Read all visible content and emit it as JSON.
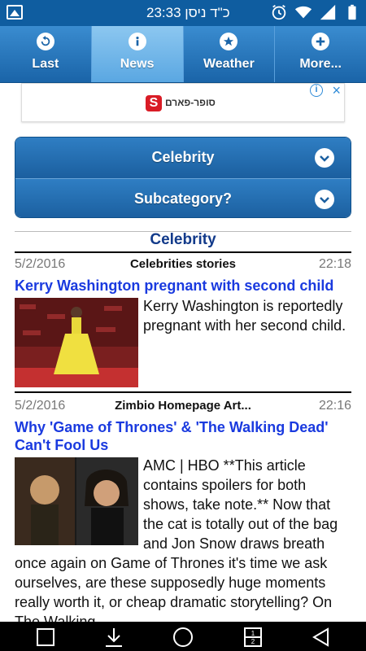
{
  "status_bar": {
    "clock": "23:33 כ\"ד ניסן",
    "icons": [
      "image-icon",
      "alarm-icon",
      "wifi-icon",
      "signal-icon",
      "battery-icon"
    ]
  },
  "tabs": [
    {
      "label": "Last",
      "icon": "back-icon",
      "active": false
    },
    {
      "label": "News",
      "icon": "info-icon",
      "active": true
    },
    {
      "label": "Weather",
      "icon": "star-icon",
      "active": false
    },
    {
      "label": "More...",
      "icon": "plus-icon",
      "active": false
    }
  ],
  "ad": {
    "logo_text": "S",
    "text": "סופר-פארם",
    "info_icon": "info-icon",
    "close_icon": "close-icon"
  },
  "selectors": {
    "category": "Celebrity",
    "subcategory": "Subcategory?"
  },
  "section": {
    "title": "Celebrity"
  },
  "articles": [
    {
      "date": "5/2/2016",
      "source": "Celebrities stories",
      "time": "22:18",
      "headline": "Kerry Washington pregnant with second child",
      "body": "Kerry Washington is reportedly pregnant with her second child."
    },
    {
      "date": "5/2/2016",
      "source": "Zimbio Homepage Art...",
      "time": "22:16",
      "headline": "Why 'Game of Thrones' & 'The Walking Dead' Can't Fool Us",
      "body": "AMC | HBO **This article contains spoilers for both shows, take note.** Now that the cat is totally out of the bag and Jon Snow draws breath once again on Game of Thrones it's time we ask ourselves, are these supposedly huge moments really worth it, or cheap dramatic storytelling? On The Walking"
    }
  ],
  "nav_bar": {
    "buttons": [
      "square-icon",
      "download-icon",
      "circle-icon",
      "dual-window-icon",
      "back-triangle-icon"
    ],
    "dual_window_digits": [
      "1",
      "2"
    ]
  },
  "colors": {
    "status_bar": "#0f5da0",
    "nav_gradient_top": "#3a8cd0",
    "nav_gradient_bottom": "#1a64a8",
    "active_tab": "#8cc7f0",
    "headline": "#1a3adf",
    "section_title": "#123a8a"
  }
}
